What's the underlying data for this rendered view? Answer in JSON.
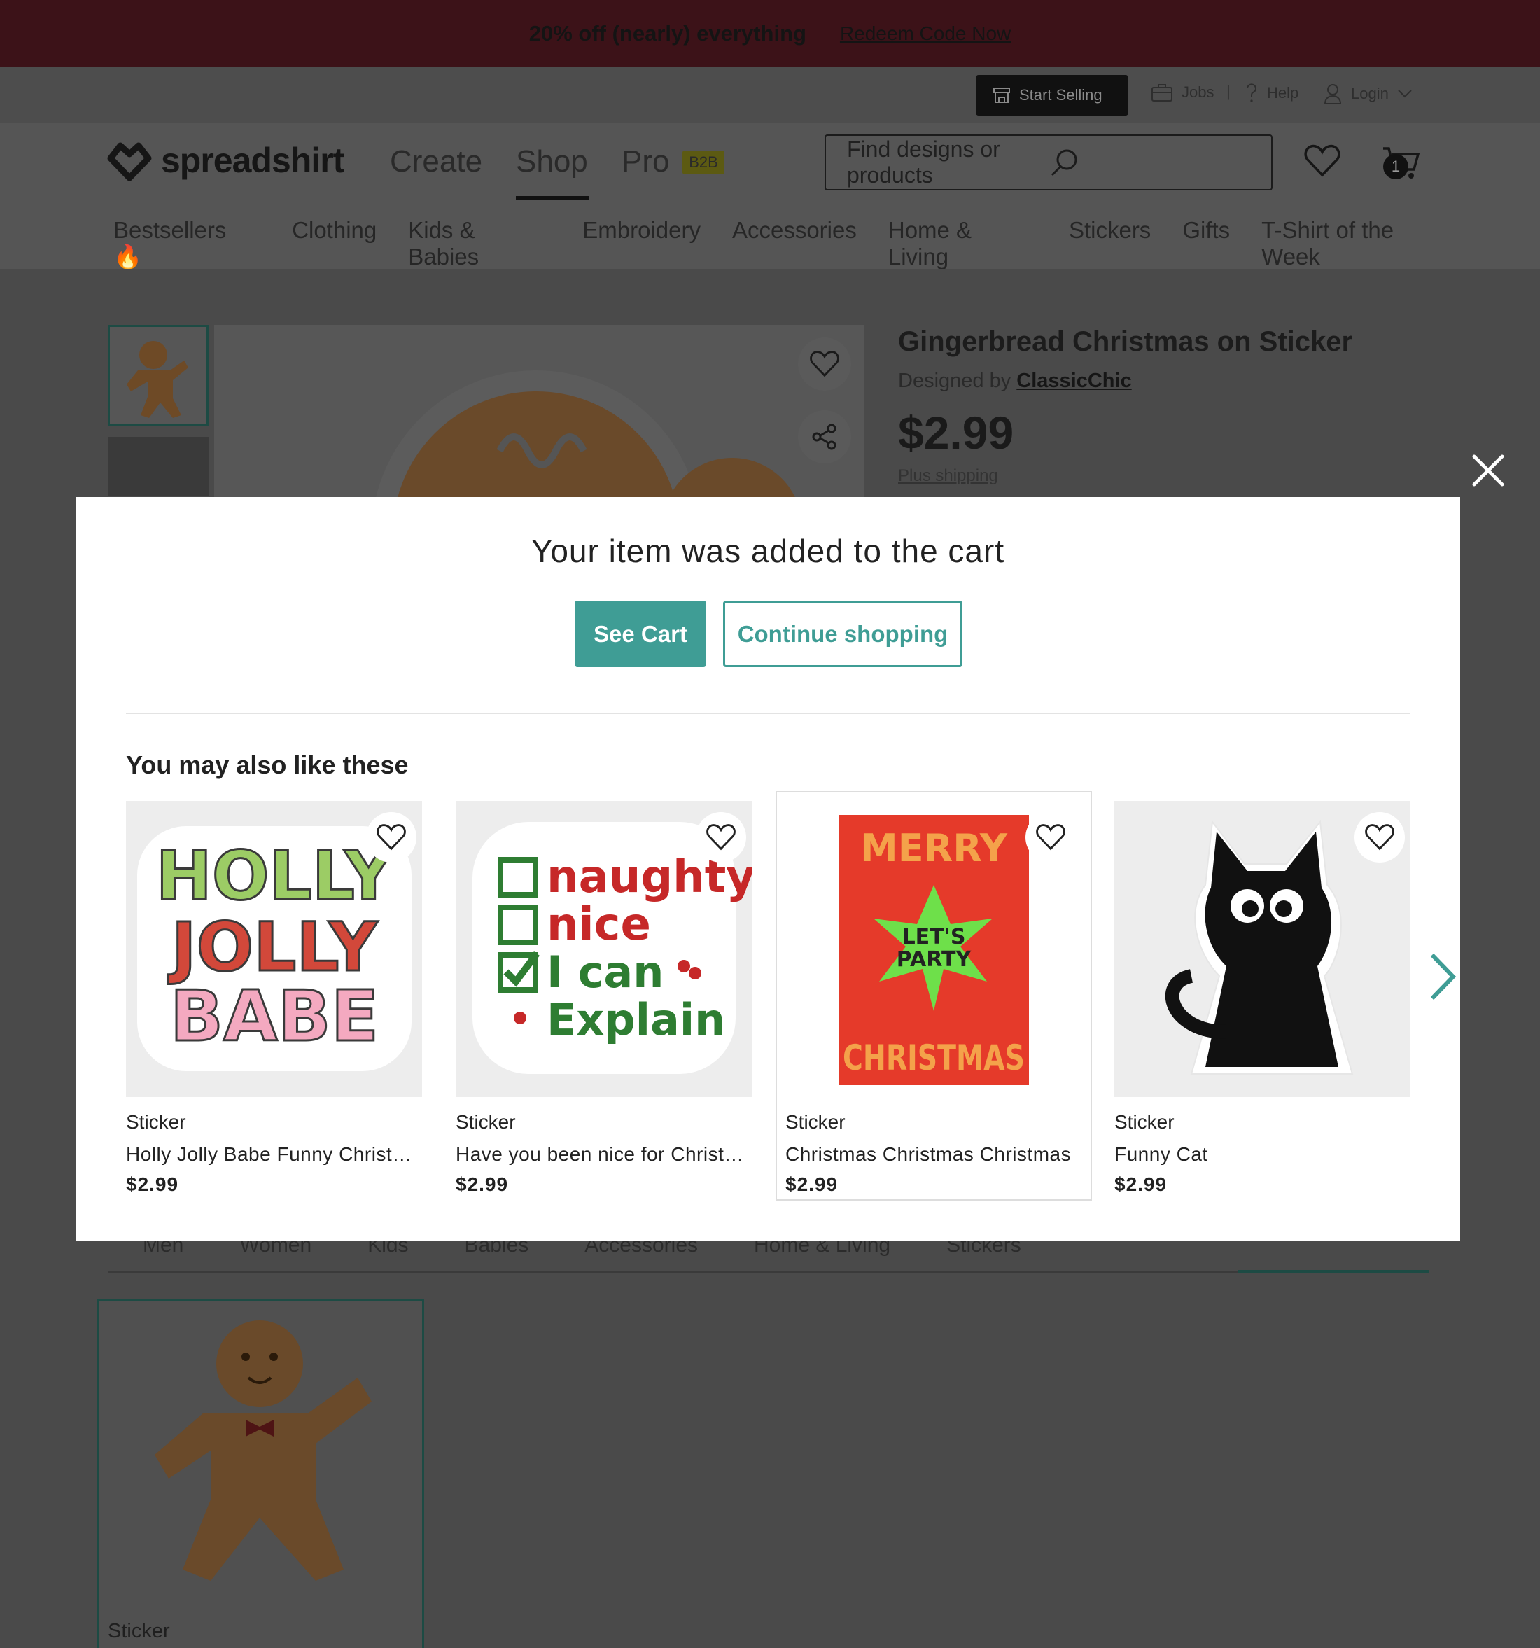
{
  "promo": {
    "text": "20% off (nearly) everything",
    "link": "Redeem Code Now"
  },
  "utility": {
    "start_selling": "Start Selling",
    "jobs": "Jobs",
    "separator": "|",
    "help": "Help",
    "login": "Login"
  },
  "header": {
    "logo": "spreadshirt",
    "nav": [
      "Create",
      "Shop",
      "Pro"
    ],
    "pro_badge": "B2B",
    "search_placeholder": "Find designs or products",
    "cart_count": "1"
  },
  "categories": [
    "Bestsellers 🔥",
    "Clothing",
    "Kids & Babies",
    "Embroidery",
    "Accessories",
    "Home & Living",
    "Stickers",
    "Gifts",
    "T-Shirt of the Week"
  ],
  "product": {
    "title": "Gingerbread Christmas on Sticker",
    "designed_by_prefix": "Designed by",
    "designer": "ClassicChic",
    "price": "$2.99",
    "shipping": "Plus shipping"
  },
  "bg_tabs": [
    "Men",
    "Women",
    "Kids",
    "Babies",
    "Accessories",
    "Home & Living",
    "Stickers"
  ],
  "bg_card": {
    "type": "Sticker"
  },
  "modal": {
    "title": "Your item was added to the cart",
    "see_cart": "See Cart",
    "continue": "Continue shopping",
    "recs_heading": "You may also like these",
    "recs": [
      {
        "type": "Sticker",
        "name": "Holly Jolly Babe Funny Christmas",
        "price": "$2.99",
        "art": [
          "HOLLY",
          "JOLLY",
          "BABE"
        ]
      },
      {
        "type": "Sticker",
        "name": "Have you been nice for Christmas",
        "price": "$2.99",
        "art": [
          "naughty",
          "nice",
          "I can",
          "Explain"
        ]
      },
      {
        "type": "Sticker",
        "name": "Christmas Christmas Christmas",
        "price": "$2.99",
        "art": [
          "MERRY",
          "LET'S",
          "PARTY",
          "CHRISTMAS"
        ]
      },
      {
        "type": "Sticker",
        "name": "Funny Cat",
        "price": "$2.99"
      }
    ]
  },
  "colors": {
    "teal": "#3f9d95",
    "promo_bg": "#3c1218"
  }
}
